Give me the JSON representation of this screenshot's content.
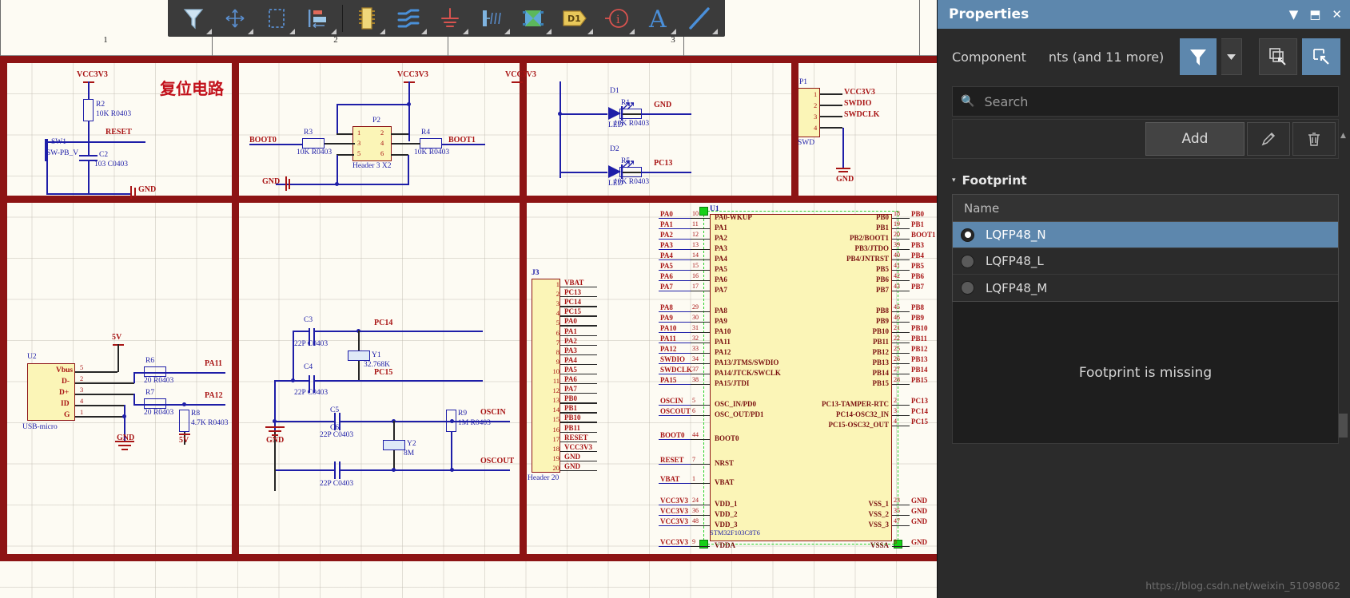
{
  "toolbar": {
    "items": [
      {
        "name": "filter-tool",
        "label": "Filter"
      },
      {
        "name": "move-tool",
        "label": "Move"
      },
      {
        "name": "area-select-tool",
        "label": "Area Select"
      },
      {
        "name": "align-tool",
        "label": "Align"
      },
      {
        "name": "place-component-tool",
        "label": "Place Component"
      },
      {
        "name": "place-wire-tool",
        "label": "Place Wire"
      },
      {
        "name": "place-ground-tool",
        "label": "Place Ground"
      },
      {
        "name": "place-netlabel-tool",
        "label": "Place Net Label"
      },
      {
        "name": "place-port-tool",
        "label": "Place Port"
      },
      {
        "name": "place-designator-tool",
        "label": "Place Designator"
      },
      {
        "name": "place-nodirective-tool",
        "label": "No ERC Directive"
      },
      {
        "name": "place-text-tool",
        "label": "Place Text"
      },
      {
        "name": "place-line-tool",
        "label": "Place Line"
      }
    ]
  },
  "ruler": {
    "marks": [
      "1",
      "2",
      "3"
    ]
  },
  "properties": {
    "title": "Properties",
    "title_icons": [
      {
        "name": "collapse-icon",
        "glyph": "▼"
      },
      {
        "name": "pin-icon",
        "glyph": "⬒"
      },
      {
        "name": "close-icon",
        "glyph": "✕"
      }
    ],
    "object_type": "Component",
    "selection_summary": "nts (and 11 more)",
    "filter_button_label": "",
    "search": {
      "placeholder": "Search",
      "value": ""
    },
    "add_button": "Add",
    "edit_button_icon": "pencil-icon",
    "delete_button_icon": "trash-icon",
    "footprint_section": {
      "title": "Footprint",
      "column_header": "Name",
      "rows": [
        {
          "name": "LQFP48_N",
          "selected": true
        },
        {
          "name": "LQFP48_L",
          "selected": false
        },
        {
          "name": "LQFP48_M",
          "selected": false
        }
      ],
      "preview_message": "Footprint is missing"
    },
    "accent_color": "#5d87ad",
    "panel_bg": "#2b2b2b"
  },
  "watermark": "https://blog.csdn.net/weixin_51098062",
  "schematic": {
    "title_cn": "复位电路",
    "blocks": {
      "reset": {
        "power": "VCC3V3",
        "r2": {
          "ref": "R2",
          "value": "10K R0403"
        },
        "net_reset": "RESET",
        "sw1": {
          "ref": "SW1",
          "value": "SW-PB_V"
        },
        "c2": {
          "ref": "C2",
          "value": "103 C0403"
        },
        "gnd": "GND"
      },
      "boot": {
        "power": "VCC3V3",
        "p2": {
          "ref": "P2",
          "value": "Header 3 X2",
          "pins": [
            "1",
            "2",
            "3",
            "4",
            "5",
            "6"
          ]
        },
        "r3": {
          "ref": "R3",
          "value": "10K R0403"
        },
        "r4": {
          "ref": "R4",
          "value": "10K R0403"
        },
        "net_boot0": "BOOT0",
        "net_boot1": "BOOT1",
        "gnd": "GND"
      },
      "led": {
        "power": "VCC3V3",
        "d1": {
          "ref": "D1",
          "value": "LED"
        },
        "d2": {
          "ref": "D2",
          "value": "LED"
        },
        "r1": {
          "ref": "R1",
          "value": "10K R0403"
        },
        "r5": {
          "ref": "R5",
          "value": "10K R0403"
        },
        "net_gnd": "GND",
        "net_pc13": "PC13"
      },
      "swd": {
        "p1": {
          "ref": "P1",
          "value": "SWD",
          "pins": [
            "1",
            "2",
            "3",
            "4"
          ]
        },
        "nets": [
          "VCC3V3",
          "SWDIO",
          "SWDCLK",
          "GND"
        ]
      },
      "usb": {
        "u2": {
          "ref": "U2",
          "value": "USB-micro",
          "pin_names": [
            "Vbus",
            "D-",
            "D+",
            "ID",
            "G"
          ],
          "pin_numbers": [
            "5",
            "2",
            "3",
            "4",
            "1"
          ]
        },
        "power": "5V",
        "r6": {
          "ref": "R6",
          "value": "20 R0403"
        },
        "r7": {
          "ref": "R7",
          "value": "20 R0403"
        },
        "r8": {
          "ref": "R8",
          "value": "4.7K R0403"
        },
        "net_pa11": "PA11",
        "net_pa12": "PA12",
        "gnd": "GND",
        "pullup_power": "5V"
      },
      "osc": {
        "c3": {
          "ref": "C3",
          "value": "22P C0403"
        },
        "c4": {
          "ref": "C4",
          "value": "22P C0403"
        },
        "c5": {
          "ref": "C5",
          "value": "22P C0403"
        },
        "c6": {
          "ref": "C6",
          "value": "22P C0403"
        },
        "y1": {
          "ref": "Y1",
          "value": "32.768K"
        },
        "y2": {
          "ref": "Y2",
          "value": "8M"
        },
        "r9": {
          "ref": "R9",
          "value": "1M R0403"
        },
        "net_pc14": "PC14",
        "net_pc15": "PC15",
        "net_oscin": "OSCIN",
        "net_oscout": "OSCOUT",
        "gnd": "GND"
      },
      "header_j3": {
        "ref": "J3",
        "value": "Header 20",
        "pins": [
          {
            "n": "1",
            "label": "VBAT"
          },
          {
            "n": "2",
            "label": "PC13"
          },
          {
            "n": "3",
            "label": "PC14"
          },
          {
            "n": "4",
            "label": "PC15"
          },
          {
            "n": "5",
            "label": "PA0"
          },
          {
            "n": "6",
            "label": "PA1"
          },
          {
            "n": "7",
            "label": "PA2"
          },
          {
            "n": "8",
            "label": "PA3"
          },
          {
            "n": "9",
            "label": "PA4"
          },
          {
            "n": "10",
            "label": "PA5"
          },
          {
            "n": "11",
            "label": "PA6"
          },
          {
            "n": "12",
            "label": "PA7"
          },
          {
            "n": "13",
            "label": "PB0"
          },
          {
            "n": "14",
            "label": "PB1"
          },
          {
            "n": "15",
            "label": "PB10"
          },
          {
            "n": "16",
            "label": "PB11"
          },
          {
            "n": "17",
            "label": "RESET"
          },
          {
            "n": "18",
            "label": "VCC3V3"
          },
          {
            "n": "19",
            "label": "GND"
          },
          {
            "n": "20",
            "label": "GND"
          }
        ]
      },
      "mcu": {
        "ref": "U1",
        "value": "STM32F103C8T6",
        "left_pins": [
          {
            "net": "PA0",
            "num": "10",
            "name": "PA0-WKUP"
          },
          {
            "net": "PA1",
            "num": "11",
            "name": "PA1"
          },
          {
            "net": "PA2",
            "num": "12",
            "name": "PA2"
          },
          {
            "net": "PA3",
            "num": "13",
            "name": "PA3"
          },
          {
            "net": "PA4",
            "num": "14",
            "name": "PA4"
          },
          {
            "net": "PA5",
            "num": "15",
            "name": "PA5"
          },
          {
            "net": "PA6",
            "num": "16",
            "name": "PA6"
          },
          {
            "net": "PA7",
            "num": "17",
            "name": "PA7"
          },
          {
            "net": "PA8",
            "num": "29",
            "name": "PA8"
          },
          {
            "net": "PA9",
            "num": "30",
            "name": "PA9"
          },
          {
            "net": "PA10",
            "num": "31",
            "name": "PA10"
          },
          {
            "net": "PA11",
            "num": "32",
            "name": "PA11"
          },
          {
            "net": "PA12",
            "num": "33",
            "name": "PA12"
          },
          {
            "net": "SWDIO",
            "num": "34",
            "name": "PA13/JTMS/SWDIO"
          },
          {
            "net": "SWDCLK",
            "num": "37",
            "name": "PA14/JTCK/SWCLK"
          },
          {
            "net": "PA15",
            "num": "38",
            "name": "PA15/JTDI"
          },
          {
            "net": "OSCIN",
            "num": "5",
            "name": "OSC_IN/PD0"
          },
          {
            "net": "OSCOUT",
            "num": "6",
            "name": "OSC_OUT/PD1"
          },
          {
            "net": "BOOT0",
            "num": "44",
            "name": "BOOT0"
          },
          {
            "net": "RESET",
            "num": "7",
            "name": "NRST"
          },
          {
            "net": "VBAT",
            "num": "1",
            "name": "VBAT"
          },
          {
            "net": "VCC3V3",
            "num": "24",
            "name": "VDD_1"
          },
          {
            "net": "VCC3V3",
            "num": "36",
            "name": "VDD_2"
          },
          {
            "net": "VCC3V3",
            "num": "48",
            "name": "VDD_3"
          },
          {
            "net": "VCC3V3",
            "num": "9",
            "name": "VDDA"
          }
        ],
        "right_pins": [
          {
            "name": "PB0",
            "num": "18",
            "net": "PB0"
          },
          {
            "name": "PB1",
            "num": "19",
            "net": "PB1"
          },
          {
            "name": "PB2/BOOT1",
            "num": "20",
            "net": "BOOT1"
          },
          {
            "name": "PB3/JTDO",
            "num": "39",
            "net": "PB3"
          },
          {
            "name": "PB4/JNTRST",
            "num": "40",
            "net": "PB4"
          },
          {
            "name": "PB5",
            "num": "41",
            "net": "PB5"
          },
          {
            "name": "PB6",
            "num": "42",
            "net": "PB6"
          },
          {
            "name": "PB7",
            "num": "43",
            "net": "PB7"
          },
          {
            "name": "PB8",
            "num": "45",
            "net": "PB8"
          },
          {
            "name": "PB9",
            "num": "46",
            "net": "PB9"
          },
          {
            "name": "PB10",
            "num": "21",
            "net": "PB10"
          },
          {
            "name": "PB11",
            "num": "22",
            "net": "PB11"
          },
          {
            "name": "PB12",
            "num": "25",
            "net": "PB12"
          },
          {
            "name": "PB13",
            "num": "26",
            "net": "PB13"
          },
          {
            "name": "PB14",
            "num": "27",
            "net": "PB14"
          },
          {
            "name": "PB15",
            "num": "28",
            "net": "PB15"
          },
          {
            "name": "PC13-TAMPER-RTC",
            "num": "2",
            "net": "PC13"
          },
          {
            "name": "PC14-OSC32_IN",
            "num": "3",
            "net": "PC14"
          },
          {
            "name": "PC15-OSC32_OUT",
            "num": "4",
            "net": "PC15"
          },
          {
            "name": "VSS_1",
            "num": "23",
            "net": "GND"
          },
          {
            "name": "VSS_2",
            "num": "35",
            "net": "GND"
          },
          {
            "name": "VSS_3",
            "num": "47",
            "net": "GND"
          },
          {
            "name": "VSSA",
            "num": "8",
            "net": "GND"
          }
        ]
      }
    }
  }
}
